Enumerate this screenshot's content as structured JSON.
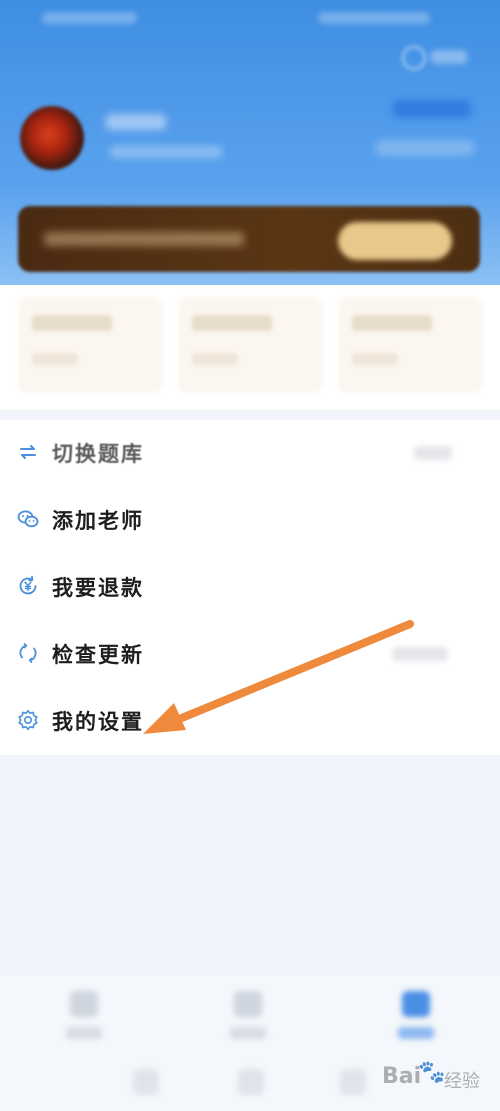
{
  "menu": {
    "items": [
      {
        "label": "切换题库",
        "icon": "swap-icon"
      },
      {
        "label": "添加老师",
        "icon": "wechat-icon"
      },
      {
        "label": "我要退款",
        "icon": "refund-icon"
      },
      {
        "label": "检查更新",
        "icon": "refresh-icon"
      },
      {
        "label": "我的设置",
        "icon": "gear-icon"
      }
    ]
  },
  "annotation": {
    "color": "#ef8a3c",
    "type": "arrow"
  },
  "watermark": {
    "text_left": "Bai",
    "glyph": "🐾",
    "text_right": "经验"
  },
  "colors": {
    "header_blue": "#4a95e8",
    "menu_icon_blue": "#4a8fdc",
    "vip_brown": "#4f2f13",
    "vip_gold": "#e9c98b"
  }
}
